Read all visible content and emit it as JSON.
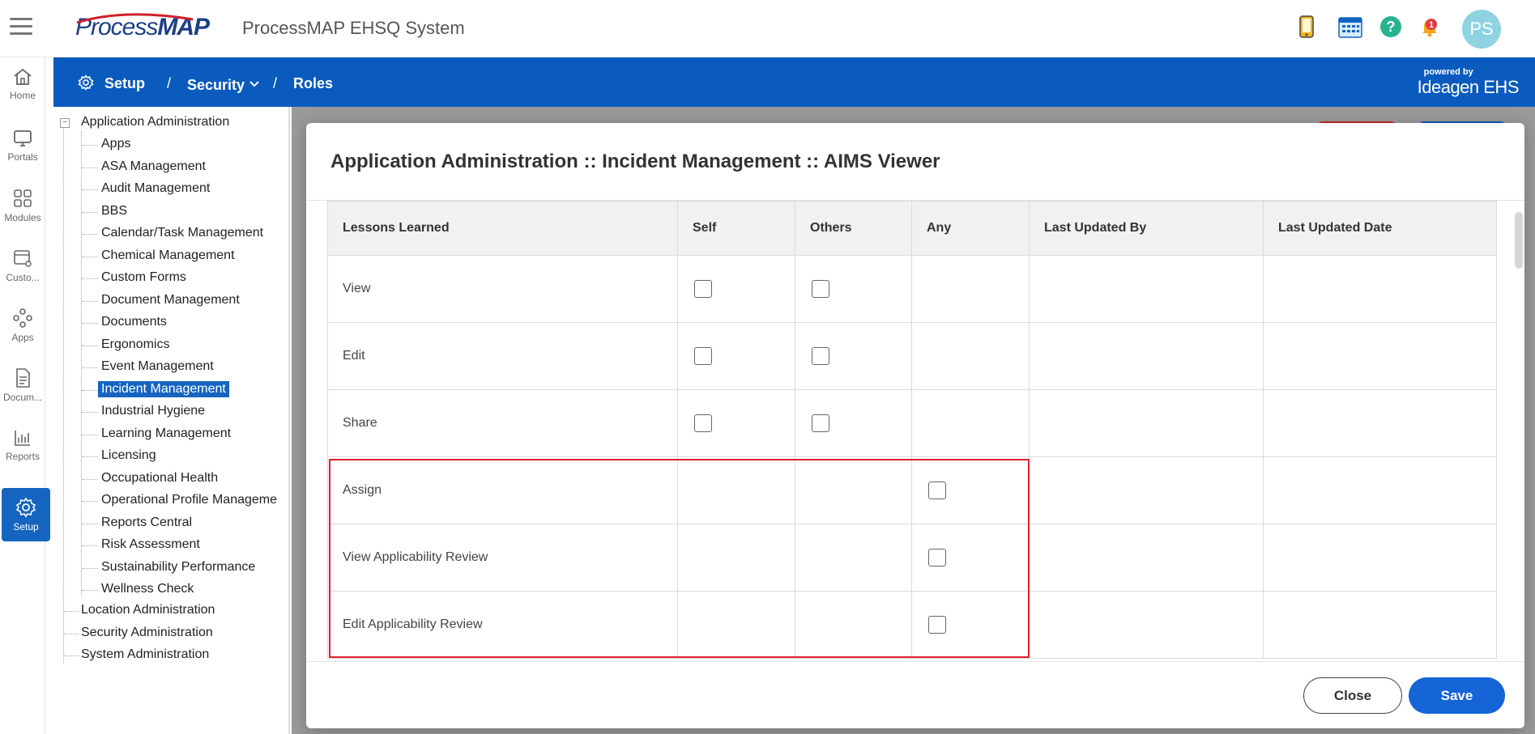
{
  "header": {
    "logo_part1": "Process",
    "logo_part2": "MAP",
    "app_title": "ProcessMAP EHSQ System",
    "icons": [
      "mobile-icon",
      "calendar-icon",
      "help-icon",
      "notification-bell-icon"
    ],
    "notification_count": "1",
    "avatar_initials": "PS"
  },
  "rail": {
    "items": [
      {
        "label": "Home",
        "icon": "home-icon"
      },
      {
        "label": "Portals",
        "icon": "monitor-icon"
      },
      {
        "label": "Modules",
        "icon": "grid-icon"
      },
      {
        "label": "Custo...",
        "icon": "custom-icon"
      },
      {
        "label": "Apps",
        "icon": "apps-icon"
      },
      {
        "label": "Docum...",
        "icon": "document-icon"
      },
      {
        "label": "Reports",
        "icon": "chart-icon"
      },
      {
        "label": "Setup",
        "icon": "gear-icon"
      }
    ]
  },
  "breadcrumb": {
    "setup": "Setup",
    "sep": "/",
    "security": "Security",
    "roles": "Roles"
  },
  "powered": {
    "line1": "powered by",
    "brand": "Ideagen EHS"
  },
  "tree": {
    "root": "Application Administration",
    "children": [
      "Apps",
      "ASA Management",
      "Audit Management",
      "BBS",
      "Calendar/Task Management",
      "Chemical Management",
      "Custom Forms",
      "Document Management",
      "Documents",
      "Ergonomics",
      "Event Management",
      "Incident Management",
      "Industrial Hygiene",
      "Learning Management",
      "Licensing",
      "Occupational Health",
      "Operational Profile Manageme",
      "Reports Central",
      "Risk Assessment",
      "Sustainability Performance",
      "Wellness Check"
    ],
    "selected": "Incident Management",
    "others": [
      "Location Administration",
      "Security Administration",
      "System Administration"
    ]
  },
  "modal": {
    "title": "Application Administration :: Incident Management :: AIMS Viewer",
    "columns": [
      "Lessons Learned",
      "Self",
      "Others",
      "Any",
      "Last Updated By",
      "Last Updated Date"
    ],
    "rows": [
      {
        "label": "View",
        "self": true,
        "others": true,
        "any": false
      },
      {
        "label": "Edit",
        "self": true,
        "others": true,
        "any": false
      },
      {
        "label": "Share",
        "self": true,
        "others": true,
        "any": false
      },
      {
        "label": "Assign",
        "self": false,
        "others": false,
        "any": true
      },
      {
        "label": "View Applicability Review",
        "self": false,
        "others": false,
        "any": true
      },
      {
        "label": "Edit Applicability Review",
        "self": false,
        "others": false,
        "any": true
      }
    ],
    "close_label": "Close",
    "save_label": "Save"
  },
  "colors": {
    "primary_blue": "#0a5bbd",
    "highlight_red": "#e0202a",
    "save_blue": "#1565d8"
  }
}
